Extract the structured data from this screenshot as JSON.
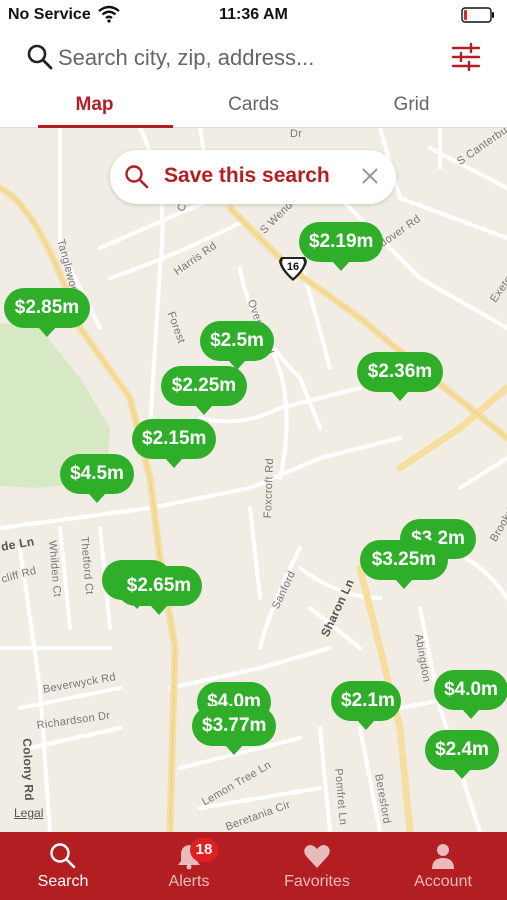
{
  "status_bar": {
    "carrier": "No Service",
    "time": "11:36 AM"
  },
  "search": {
    "placeholder": "Search city, zip, address..."
  },
  "tabs": [
    {
      "label": "Map",
      "active": true
    },
    {
      "label": "Cards",
      "active": false
    },
    {
      "label": "Grid",
      "active": false
    }
  ],
  "map": {
    "save_search_label": "Save this search",
    "highway_number": "16",
    "legal_label": "Legal",
    "streets": [
      "Harris Rd",
      "Tanglewood Ln",
      "S Wendover",
      "Andover Rd",
      "Overhill Rd",
      "Forest",
      "S Canterbury",
      "Exeter",
      "Foxcroft Rd",
      "Sanford",
      "Sharon Ln",
      "Abingdon",
      "Brookridge",
      "Thetford Ct",
      "Whilden Ct",
      "Beverwyck Rd",
      "Richardson Dr",
      "Colony Rd",
      "Lemon Tree Ln",
      "Beretania Cir",
      "Pomfret Ln",
      "Beresford",
      "de Ln",
      "cliff Rd",
      "Co",
      "Dr"
    ],
    "listings": [
      "$2.85m",
      "$2.19m",
      "$2.5m",
      "$2.25m",
      "$2.36m",
      "$2.15m",
      "$4.5m",
      "$3.2m",
      "$3.25m",
      "$2.65m",
      "$4.0m",
      "$3.77m",
      "$2.1m",
      "$4.0m",
      "$2.4m"
    ]
  },
  "tab_bar": {
    "items": [
      {
        "label": "Search",
        "icon": "search-icon",
        "active": true
      },
      {
        "label": "Alerts",
        "icon": "bell-icon",
        "active": false,
        "badge": "18"
      },
      {
        "label": "Favorites",
        "icon": "heart-icon",
        "active": false
      },
      {
        "label": "Account",
        "icon": "person-icon",
        "active": false
      }
    ]
  },
  "colors": {
    "brand": "#b31e22",
    "pin": "#2fae2a",
    "map_bg": "#f1ede4",
    "park": "#d6e9c4",
    "major_road": "#f5dea0"
  }
}
